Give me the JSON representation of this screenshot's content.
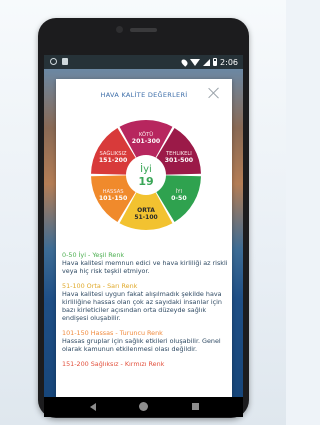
{
  "status_bar": {
    "time": "2:06"
  },
  "dialog": {
    "title": "HAVA KALİTE DEĞERLERİ",
    "center": {
      "label": "İyi",
      "value": "19"
    },
    "segments": [
      {
        "name": "Sağlıksız",
        "range": "151-200",
        "color": "#d83a3a"
      },
      {
        "name": "Kötü",
        "range": "201-300",
        "color": "#b7265e"
      },
      {
        "name": "Tehlikeli",
        "range": "301-500",
        "color": "#9b1a48"
      },
      {
        "name": "İyi",
        "range": "0-50",
        "color": "#2fa24f"
      },
      {
        "name": "Orta",
        "range": "51-100",
        "color": "#f2c230"
      },
      {
        "name": "Hassas",
        "range": "101-150",
        "color": "#f08a2c"
      }
    ],
    "legend": [
      {
        "heading": "0-50 İyi - Yeşil Renk",
        "text": "Hava kalitesi memnun edici ve hava kirliliği az riskli veya hiç risk teşkil etmiyor."
      },
      {
        "heading": "51-100 Orta - Sarı Renk",
        "text": "Hava kalitesi uygun fakat alışılmadık şekilde hava kirliliğine hassas olan çok az sayıdaki insanlar için bazı kirleticiler açısından orta düzeyde sağlık endişesi oluşabilir."
      },
      {
        "heading": "101-150 Hassas - Turuncu Renk",
        "text": "Hassas gruplar için sağlık etkileri oluşabilir. Genel olarak kamunun etkilenmesi olası değildir."
      },
      {
        "heading": "151-200 Sağlıksız - Kırmızı Renk",
        "text": ""
      }
    ]
  }
}
